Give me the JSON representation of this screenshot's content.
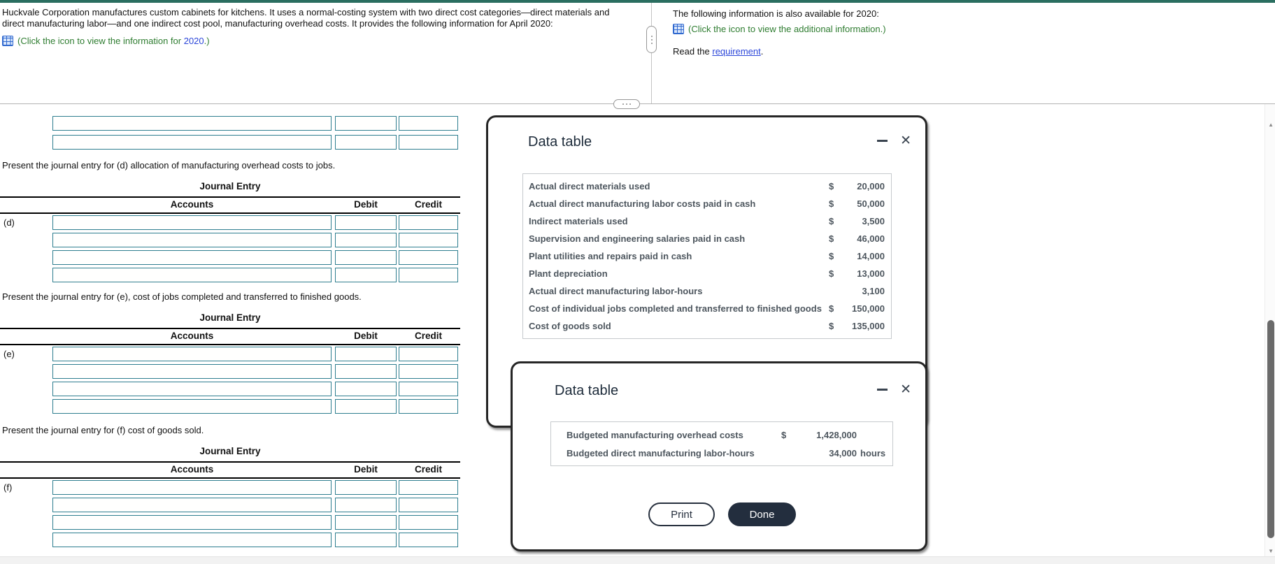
{
  "header": {
    "left": {
      "lines": [
        "Huckvale Corporation manufactures custom cabinets for kitchens. It uses a normal-costing system with two direct cost categories—direct materials and",
        "direct manufacturing labor—and one indirect cost pool, manufacturing overhead costs. It provides the following information for April 2020:"
      ],
      "click_prefix": "(Click the icon to view the information for ",
      "click_year": "2020",
      "click_suffix": ".)"
    },
    "right": {
      "intro": "The following information is also available for 2020:",
      "click_text": "(Click the icon to view the additional information.)",
      "read_prefix": "Read the ",
      "read_link": "requirement",
      "read_suffix": "."
    }
  },
  "journal": {
    "title": "Journal Entry",
    "headers": {
      "accounts": "Accounts",
      "debit": "Debit",
      "credit": "Credit"
    },
    "sections": [
      {
        "label": "(d)",
        "prompt": "Present the journal entry for (d) allocation of manufacturing overhead costs to jobs."
      },
      {
        "label": "(e)",
        "prompt": "Present the journal entry for (e), cost of jobs completed and transferred to finished goods."
      },
      {
        "label": "(f)",
        "prompt": "Present the journal entry for (f) cost of goods sold."
      }
    ]
  },
  "data_table_1": {
    "title": "Data table",
    "rows": [
      {
        "label": "Actual direct materials used",
        "currency": "$",
        "amount": "20,000"
      },
      {
        "label": "Actual direct manufacturing labor costs paid in cash",
        "currency": "$",
        "amount": "50,000"
      },
      {
        "label": "Indirect materials used",
        "currency": "$",
        "amount": "3,500"
      },
      {
        "label": "Supervision and engineering salaries paid in cash",
        "currency": "$",
        "amount": "46,000"
      },
      {
        "label": "Plant utilities and repairs paid in cash",
        "currency": "$",
        "amount": "14,000"
      },
      {
        "label": "Plant depreciation",
        "currency": "$",
        "amount": "13,000"
      },
      {
        "label": "Actual direct manufacturing labor-hours",
        "currency": "",
        "amount": "3,100"
      },
      {
        "label": "Cost of individual jobs completed and transferred to finished goods",
        "currency": "$",
        "amount": "150,000"
      },
      {
        "label": "Cost of goods sold",
        "currency": "$",
        "amount": "135,000"
      }
    ]
  },
  "data_table_2": {
    "title": "Data table",
    "rows": [
      {
        "label": "Budgeted manufacturing overhead costs",
        "currency": "$",
        "amount": "1,428,000",
        "suffix": ""
      },
      {
        "label": "Budgeted direct manufacturing labor-hours",
        "currency": "",
        "amount": "34,000",
        "suffix": "hours"
      }
    ],
    "print_label": "Print",
    "done_label": "Done"
  },
  "colors": {
    "top_bar": "#2a6e60",
    "input_border": "#2e7e8f",
    "instruction_green": "#2f7d31",
    "link_blue": "#2b46d9",
    "done_button": "#232e3e"
  }
}
